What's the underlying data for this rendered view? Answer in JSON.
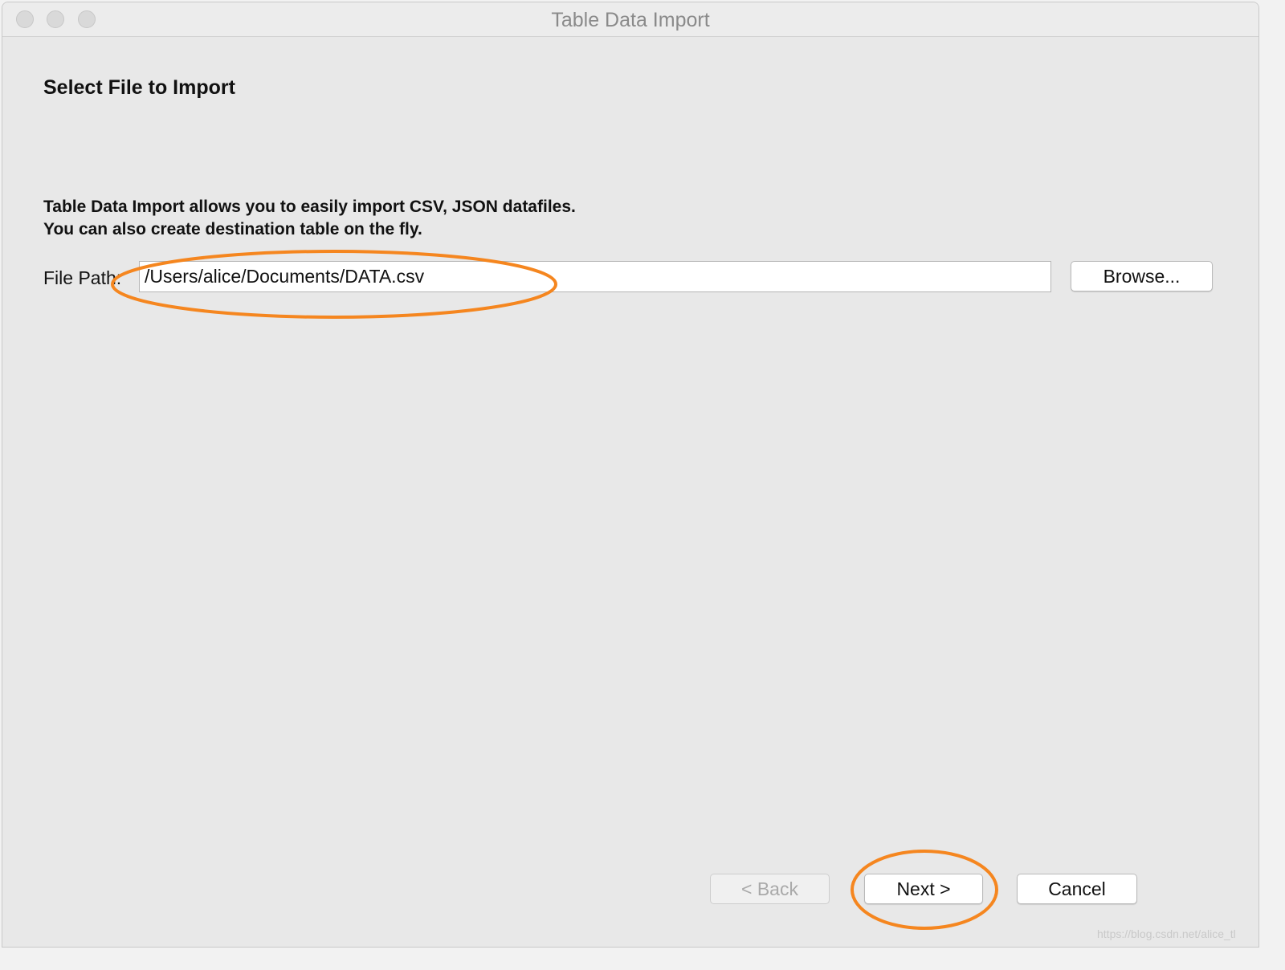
{
  "window": {
    "title": "Table Data Import"
  },
  "page": {
    "heading": "Select File to Import",
    "description_line1": "Table Data Import allows you to easily import CSV, JSON datafiles.",
    "description_line2": "You can also create destination table on the fly."
  },
  "file_path": {
    "label": "File Path:",
    "value": "/Users/alice/Documents/DATA.csv"
  },
  "buttons": {
    "browse": "Browse...",
    "back": "< Back",
    "next": "Next >",
    "cancel": "Cancel"
  },
  "annotation": {
    "color": "#f5861f"
  },
  "watermark": "https://blog.csdn.net/alice_tl"
}
